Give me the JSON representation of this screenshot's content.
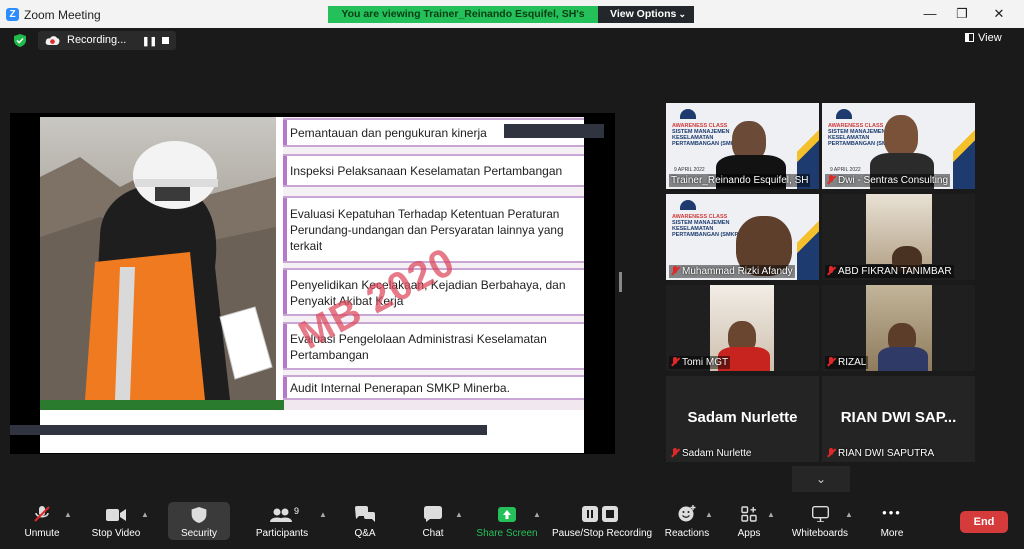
{
  "window": {
    "title": "Zoom Meeting",
    "logo_letter": "Z",
    "controls": {
      "minimize": "—",
      "restore": "❐",
      "close": "✕"
    }
  },
  "banner": {
    "text": "You are viewing Trainer_Reinando Esquifel, SH's screen",
    "view_options": "View Options"
  },
  "recording": {
    "label": "Recording...",
    "pause_glyph": "❚❚"
  },
  "view_button": "View",
  "slide": {
    "watermark": "MB 2020",
    "items": [
      "Pemantauan dan pengukuran kinerja",
      "Inspeksi Pelaksanaan Keselamatan Pertambangan",
      "Evaluasi Kepatuhan Terhadap Ketentuan Peraturan Perundang-undangan dan Persyaratan lainnya yang terkait",
      "Penyelidikan Kecelakaan, Kejadian Berbahaya, dan Penyakit Akibat Kerja",
      "Evaluasi Pengelolaan Administrasi Keselamatan Pertambangan",
      "Audit Internal Penerapan SMKP Minerba."
    ]
  },
  "thumb": {
    "title": "AWARENESS CLASS",
    "subtitle": "SISTEM MANAJEMEN KESELAMATAN PERTAMBANGAN (SMKP)",
    "date": "9 APRIL 2022"
  },
  "participants": [
    {
      "name": "Trainer_Reinando Esquifel, SH",
      "muted": false,
      "active": true
    },
    {
      "name": "Dwi - Sentras Consulting",
      "muted": true
    },
    {
      "name": "Muhammad Rizki Afandy",
      "muted": true
    },
    {
      "name": "ABD FIKRAN TANIMBAR",
      "muted": true
    },
    {
      "name": "Tomi MGT",
      "muted": true
    },
    {
      "name": "RIZAL",
      "muted": true
    },
    {
      "name": "Sadam Nurlette",
      "big": "Sadam Nurlette",
      "muted": true
    },
    {
      "name": "RIAN DWI SAPUTRA",
      "big": "RIAN DWI SAP...",
      "muted": true
    }
  ],
  "scroll_glyph": "⌄",
  "toolbar": {
    "unmute": "Unmute",
    "stop_video": "Stop Video",
    "security": "Security",
    "participants": "Participants",
    "participants_count": "9",
    "qa": "Q&A",
    "chat": "Chat",
    "share_screen": "Share Screen",
    "pause_stop_recording": "Pause/Stop Recording",
    "reactions": "Reactions",
    "apps": "Apps",
    "whiteboards": "Whiteboards",
    "more": "More",
    "end": "End"
  },
  "colors": {
    "share_green": "#24c05a",
    "end_red": "#d63b3b",
    "active_outline": "#c8d33a",
    "muted_red": "#e02828"
  }
}
